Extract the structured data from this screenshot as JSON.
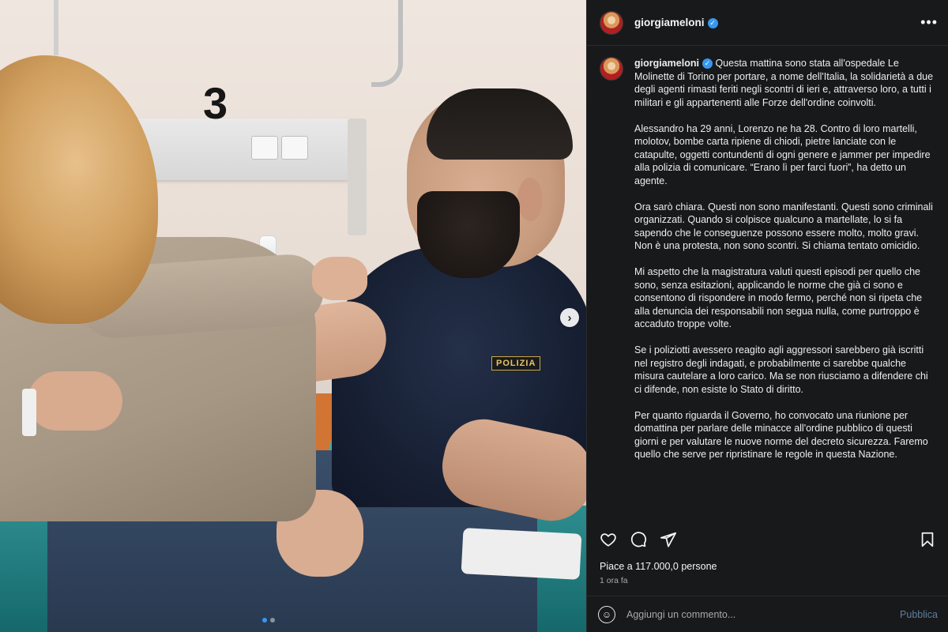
{
  "post": {
    "username": "giorgiameloni",
    "verified": true,
    "caption_paragraphs": [
      "Questa mattina sono stata all'ospedale Le Molinette di Torino per portare, a nome dell'Italia, la solidarietà a due degli agenti rimasti feriti negli scontri di ieri e, attraverso loro, a tutti i militari e gli appartenenti alle Forze dell'ordine coinvolti.",
      "Alessandro ha 29 anni, Lorenzo ne ha 28. Contro di loro martelli, molotov, bombe carta ripiene di chiodi, pietre lanciate con le catapulte, oggetti contundenti di ogni genere e jammer per impedire alla polizia di comunicare. “Erano lì per farci fuori”, ha detto un agente.",
      "Ora sarò chiara. Questi non sono manifestanti. Questi sono criminali organizzati. Quando si colpisce qualcuno a martellate, lo si fa sapendo che le conseguenze possono essere molto, molto gravi.",
      "Non è una protesta, non sono scontri. Si chiama tentato omicidio.",
      "Mi aspetto che la magistratura valuti questi episodi per quello che sono, senza esitazioni, applicando le norme che già ci sono e consentono di rispondere in modo fermo, perché non si ripeta che alla denuncia dei responsabili non segua nulla, come purtroppo è accaduto troppe volte.",
      "Se i poliziotti avessero reagito agli aggressori sarebbero già iscritti nel registro degli indagati, e probabilmente ci sarebbe qualche misura cautelare a loro carico. Ma se non riusciamo a difendere chi ci difende, non esiste lo Stato di diritto.",
      "Per quanto riguarda il Governo, ho convocato una riunione per domattina per parlare delle minacce all'ordine pubblico di questi giorni e per valutare le nuove norme del decreto sicurezza. Faremo quello che serve per ripristinare le regole in questa Nazione."
    ],
    "likes_text": "Piace a 117.000,0 persone",
    "time_ago": "1 ora fa"
  },
  "photo": {
    "bed_number": "3",
    "badge_text": "POLIZIA",
    "next_arrow": "›",
    "carousel_total": 2,
    "carousel_active": 0
  },
  "header": {
    "more_icon": "•••"
  },
  "icons": [
    "heart-icon",
    "comment-icon",
    "share-icon",
    "bookmark-icon",
    "emoji-icon",
    "verified-icon",
    "more-icon"
  ],
  "comment": {
    "placeholder": "Aggiungi un commento...",
    "publish_label": "Pubblica"
  },
  "colors": {
    "sidebar_bg": "#18191b",
    "verified_blue": "#3897f0",
    "publish_muted": "#5f7f9e"
  }
}
